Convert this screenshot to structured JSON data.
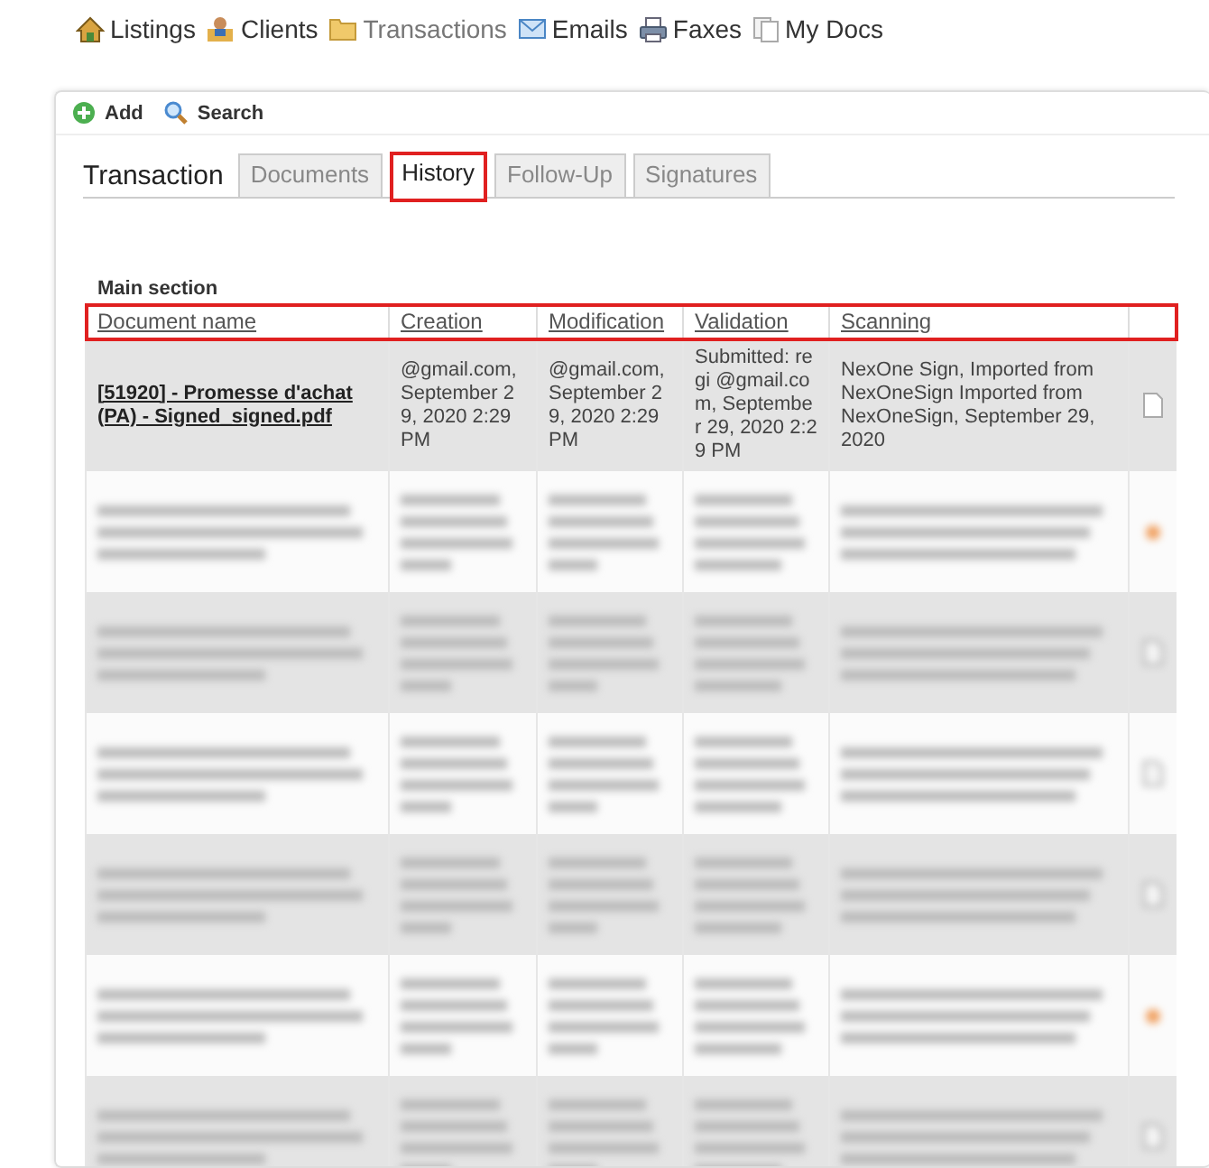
{
  "nav": [
    {
      "label": "Listings",
      "selected": false
    },
    {
      "label": "Clients",
      "selected": false
    },
    {
      "label": "Transactions",
      "selected": true
    },
    {
      "label": "Emails",
      "selected": false
    },
    {
      "label": "Faxes",
      "selected": false
    },
    {
      "label": "My Docs",
      "selected": false
    }
  ],
  "toolbar": [
    {
      "label": "Add"
    },
    {
      "label": "Search"
    }
  ],
  "title": "Transaction",
  "tabs": [
    {
      "label": "Documents",
      "selected": false,
      "highlighted": false
    },
    {
      "label": "History",
      "selected": true,
      "highlighted": true
    },
    {
      "label": "Follow-Up",
      "selected": false,
      "highlighted": false
    },
    {
      "label": "Signatures",
      "selected": false,
      "highlighted": false
    }
  ],
  "section": "Main section",
  "table": {
    "header_highlighted": true,
    "columns": [
      "Document name",
      "Creation",
      "Modification",
      "Validation",
      "Scanning"
    ],
    "rows": [
      {
        "kind": "visible",
        "document": "[51920] - Promesse d'achat (PA) - Signed_signed.pdf",
        "creation": "@gmail.com, September 29, 2020 2:29 PM",
        "modification": "@gmail.com, September 29, 2020 2:29 PM",
        "validation": "Submitted: regi @gmail.com, September 29, 2020 2:29 PM",
        "scanning": "NexOne Sign, Imported from NexOneSign Imported from NexOneSign, September 29, 2020"
      },
      {
        "kind": "blurred",
        "flagged": true
      },
      {
        "kind": "blurred",
        "flagged": false
      },
      {
        "kind": "blurred",
        "flagged": false
      },
      {
        "kind": "blurred",
        "flagged": false
      },
      {
        "kind": "blurred",
        "flagged": true
      },
      {
        "kind": "blurred",
        "flagged": false
      }
    ]
  }
}
